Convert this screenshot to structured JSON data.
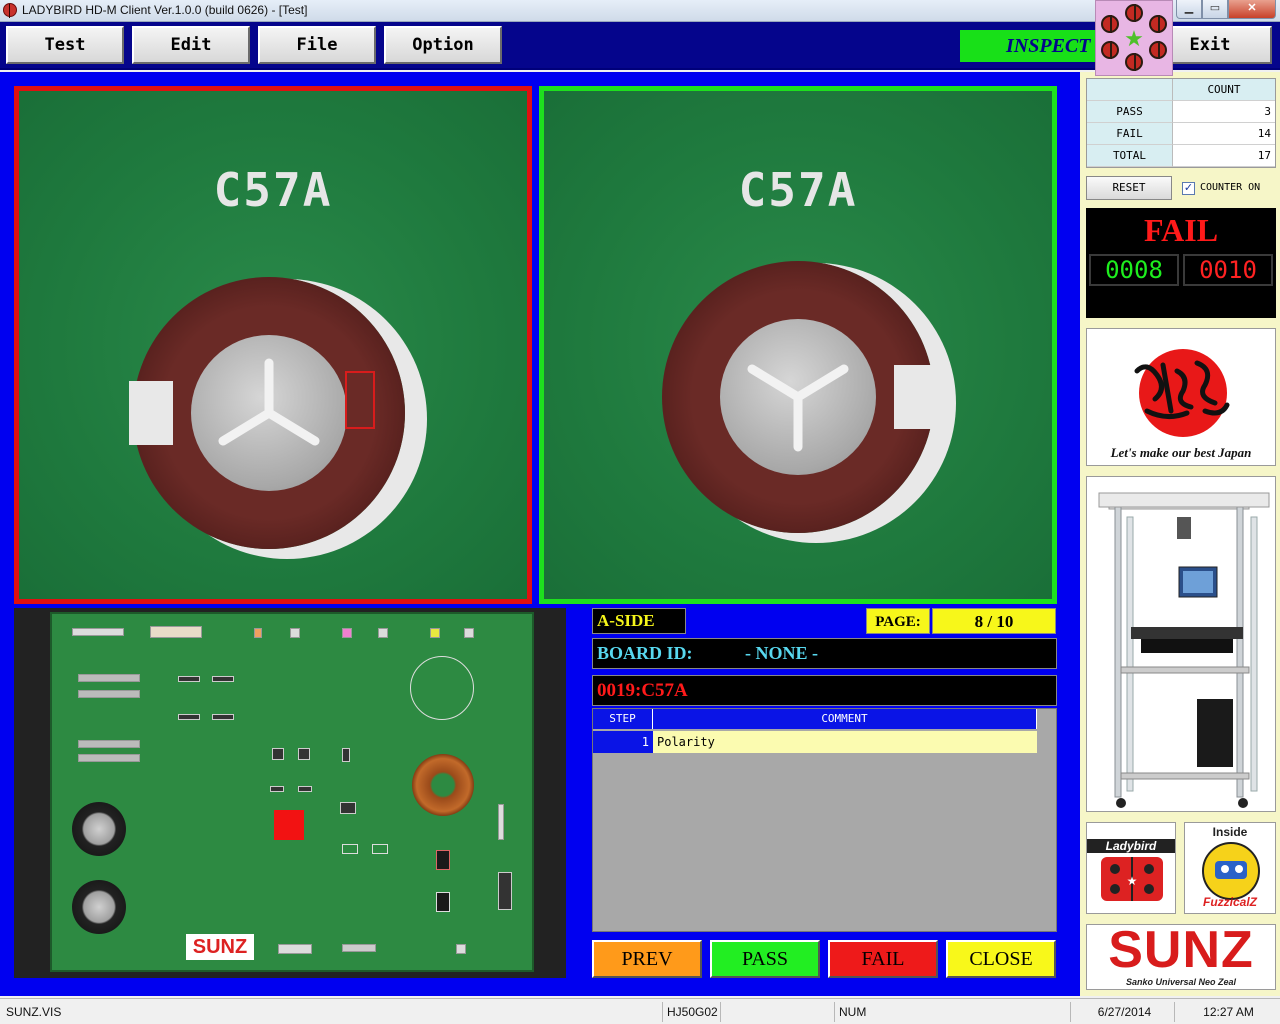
{
  "window": {
    "title": "LADYBIRD HD-M Client Ver.1.0.0  (build 0626) - [Test]",
    "min_glyph": "▁",
    "max_glyph": "▭",
    "close_glyph": "✕"
  },
  "toolbar": {
    "test_label": "Test",
    "edit_label": "Edit",
    "file_label": "File",
    "option_label": "Option",
    "exit_label": "Exit",
    "mode_banner": "INSPECT"
  },
  "camera": {
    "left_label": "C57A",
    "right_label": "C57A",
    "left_border_color": "#e01010",
    "right_border_color": "#1ee01e"
  },
  "board": {
    "logo_text": "SUNZ"
  },
  "info": {
    "side": "A-SIDE",
    "page_label": "PAGE:",
    "page_value": "8 / 10",
    "board_id_label": "BOARD ID:",
    "board_id_value": "- NONE -",
    "part_name": "0019:C57A"
  },
  "steps": {
    "headers": [
      "STEP",
      "COMMENT"
    ],
    "rows": [
      {
        "step": "1",
        "comment": "Polarity"
      }
    ]
  },
  "actions": {
    "prev": "PREV",
    "pass": "PASS",
    "fail": "FAIL",
    "close": "CLOSE"
  },
  "counter": {
    "header": "COUNT",
    "rows": [
      {
        "label": "PASS",
        "value": "3"
      },
      {
        "label": "FAIL",
        "value": "14"
      },
      {
        "label": "TOTAL",
        "value": "17"
      }
    ],
    "reset_label": "RESET",
    "counter_on_label": "COUNTER ON",
    "counter_on_checked": true,
    "check_glyph": "✓"
  },
  "result": {
    "text": "FAIL",
    "left_count": "0008",
    "right_count": "0010",
    "text_color": "#ff1a1a"
  },
  "logos": {
    "japan_caption": "Let's make our best Japan",
    "ladybird_text": "Ladybird",
    "fuzzical_inside": "Inside",
    "fuzzical_name": "FuzzicalZ",
    "sunz_word": "SUNZ",
    "sunz_tagline": "Sanko Universal Neo Zeal"
  },
  "status": {
    "file": "SUNZ.VIS",
    "model": "HJ50G02",
    "num": "NUM",
    "date": "6/27/2014",
    "time": "12:27 AM"
  }
}
